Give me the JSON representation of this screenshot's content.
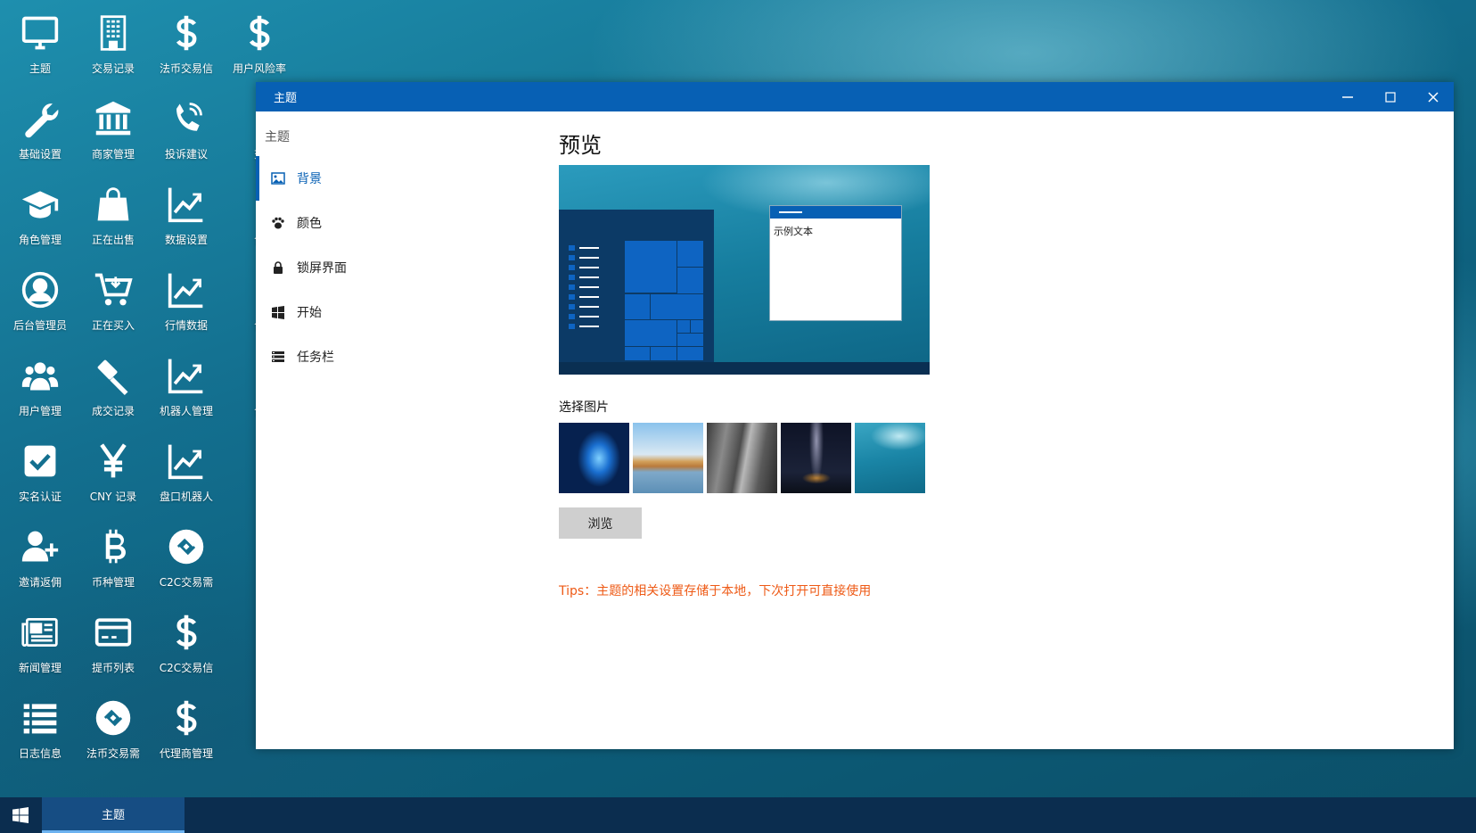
{
  "desktop": {
    "icons": [
      {
        "label": "主题",
        "icon": "monitor-icon"
      },
      {
        "label": "交易记录",
        "icon": "building-icon"
      },
      {
        "label": "法币交易信",
        "icon": "dollar-icon"
      },
      {
        "label": "用户风险率",
        "icon": "dollar-icon"
      },
      {
        "label": "基础设置",
        "icon": "wrench-icon"
      },
      {
        "label": "商家管理",
        "icon": "bank-icon"
      },
      {
        "label": "投诉建议",
        "icon": "phone-icon"
      },
      {
        "label": "交",
        "icon": "hidden-icon"
      },
      {
        "label": "角色管理",
        "icon": "graduation-cap-icon"
      },
      {
        "label": "正在出售",
        "icon": "shopping-bag-icon"
      },
      {
        "label": "数据设置",
        "icon": "chart-line-icon"
      },
      {
        "label": "合",
        "icon": "hidden-icon"
      },
      {
        "label": "后台管理员",
        "icon": "user-circle-icon"
      },
      {
        "label": "正在买入",
        "icon": "cart-icon"
      },
      {
        "label": "行情数据",
        "icon": "chart-line-icon"
      },
      {
        "label": "合",
        "icon": "hidden-icon"
      },
      {
        "label": "用户管理",
        "icon": "users-icon"
      },
      {
        "label": "成交记录",
        "icon": "gavel-icon"
      },
      {
        "label": "机器人管理",
        "icon": "chart-line-icon"
      },
      {
        "label": "合",
        "icon": "hidden-icon"
      },
      {
        "label": "实名认证",
        "icon": "check-square-icon"
      },
      {
        "label": "CNY 记录",
        "icon": "yen-icon"
      },
      {
        "label": "盘口机器人",
        "icon": "chart-line-icon"
      },
      {
        "label": "邀请返佣",
        "icon": "user-plus-icon"
      },
      {
        "label": "币种管理",
        "icon": "bitcoin-icon"
      },
      {
        "label": "C2C交易需",
        "icon": "exchange-circle-icon"
      },
      {
        "label": "新闻管理",
        "icon": "newspaper-icon"
      },
      {
        "label": "提币列表",
        "icon": "credit-card-icon"
      },
      {
        "label": "C2C交易信",
        "icon": "dollar-icon"
      },
      {
        "label": "日志信息",
        "icon": "list-icon"
      },
      {
        "label": "法币交易需",
        "icon": "exchange-circle-icon"
      },
      {
        "label": "代理商管理",
        "icon": "dollar-icon"
      }
    ]
  },
  "window": {
    "title": "主题",
    "sidebar": {
      "title": "主题",
      "items": [
        {
          "label": "背景",
          "icon": "image-icon",
          "active": true
        },
        {
          "label": "颜色",
          "icon": "paw-icon",
          "active": false
        },
        {
          "label": "锁屏界面",
          "icon": "lock-icon",
          "active": false
        },
        {
          "label": "开始",
          "icon": "windows-icon",
          "active": false
        },
        {
          "label": "任务栏",
          "icon": "taskbar-icon",
          "active": false
        }
      ]
    },
    "main": {
      "preview_heading": "预览",
      "preview_window_text": "示例文本",
      "choose_heading": "选择图片",
      "thumbnails": [
        "windows-10-wallpaper",
        "sea-rocks-wallpaper",
        "rock-wall-wallpaper",
        "night-sky-wallpaper",
        "underwater-wallpaper"
      ],
      "browse_label": "浏览",
      "tips": "Tips：主题的相关设置存储于本地，下次打开可直接使用"
    }
  },
  "taskbar": {
    "active_item": "主题"
  },
  "colors": {
    "accent": "#0760b4",
    "taskbar": "#0b2d4f",
    "tips": "#ee5a16"
  }
}
